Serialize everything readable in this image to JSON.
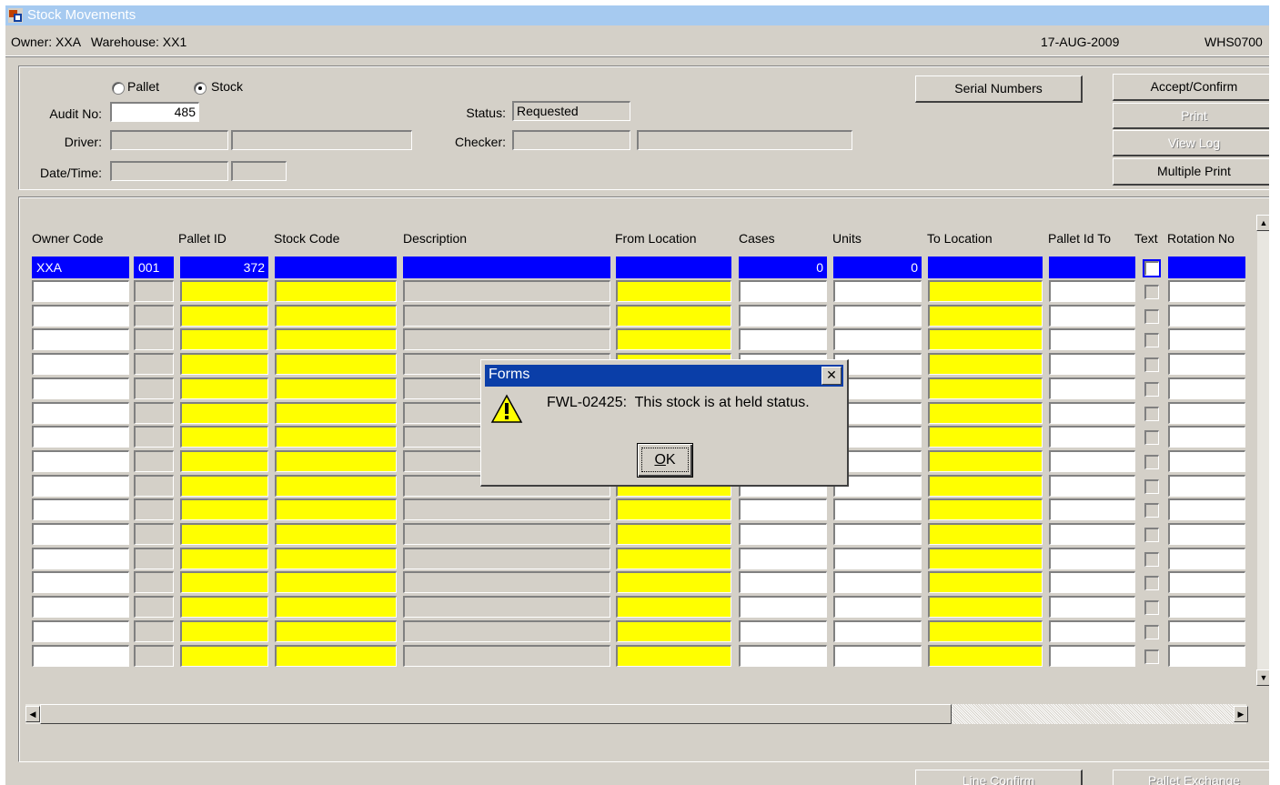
{
  "window": {
    "title": "Stock Movements"
  },
  "info": {
    "owner": "Owner: XXA   Warehouse: XX1",
    "date": "17-AUG-2009",
    "form_code": "WHS0700"
  },
  "header": {
    "radio_pallet": "Pallet",
    "radio_stock": "Stock",
    "audit_label": "Audit No:",
    "audit_value": "485",
    "driver_label": "Driver:",
    "datetime_label": "Date/Time:",
    "status_label": "Status:",
    "status_value": "Requested",
    "checker_label": "Checker:"
  },
  "buttons": {
    "serial_numbers": "Serial Numbers",
    "accept_confirm": "Accept/Confirm",
    "print": "Print",
    "view_log": "View Log",
    "multiple_print": "Multiple Print"
  },
  "table": {
    "columns": [
      "Owner Code",
      "Pallet ID",
      "Stock Code",
      "Description",
      "From Location",
      "Cases",
      "Units",
      "To Location",
      "Pallet Id To",
      "Text",
      "Rotation No"
    ],
    "row1": {
      "owner_code": "XXA",
      "seq": "001",
      "pallet_id": "372",
      "cases": "0",
      "units": "0"
    }
  },
  "dialog": {
    "title": "Forms",
    "message": "FWL-02425:  This stock is at held status.",
    "ok": "OK"
  },
  "bottom_buttons": {
    "line_confirm": "Line Confirm",
    "pallet_exchange": "Pallet Exchange"
  },
  "colors": {
    "selected_row": "#0000ff",
    "mandatory": "#ffff00",
    "dialog_title": "#0a3ea8",
    "window_title": "#a6caf0"
  }
}
